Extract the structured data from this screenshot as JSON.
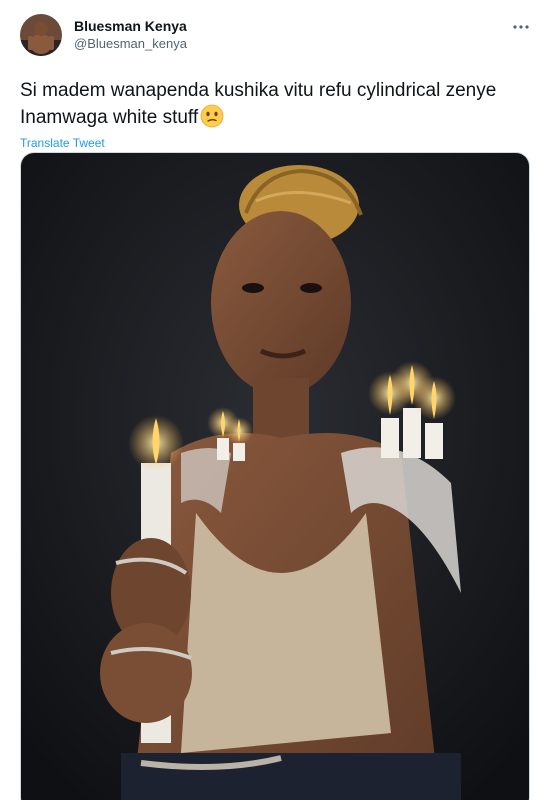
{
  "author": {
    "display_name": "Bluesman Kenya",
    "handle": "@Bluesman_kenya",
    "avatar_icon": "user-avatar-photo"
  },
  "menu": {
    "icon": "more-horizontal-icon"
  },
  "tweet": {
    "text": "Si madem wanapenda kushika vitu refu cylindrical zenye Inamwaga white stuff",
    "emoji": "confused-face-emoji",
    "translate_label": "Translate Tweet"
  },
  "media": {
    "kind": "photo"
  },
  "colors": {
    "link": "#1d9bf0",
    "muted": "#536471",
    "text": "#0f1419"
  }
}
